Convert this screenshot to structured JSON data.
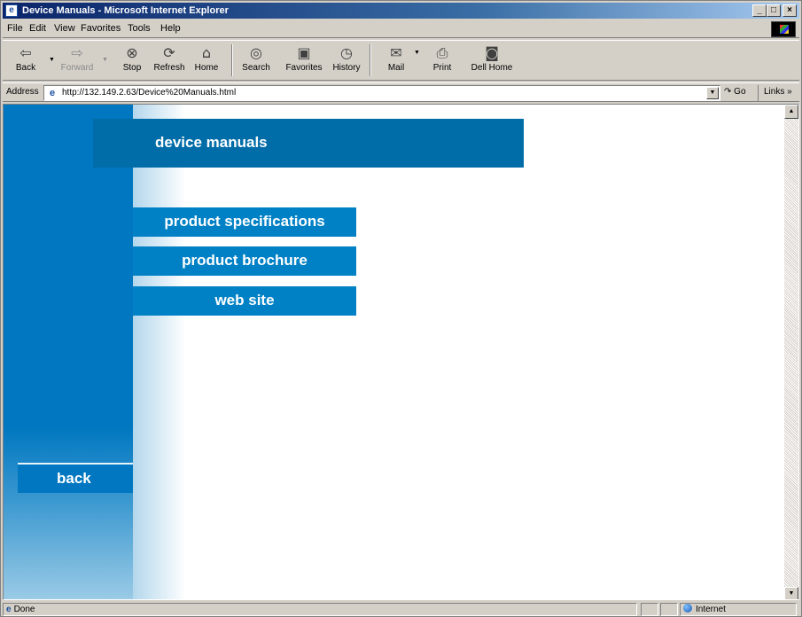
{
  "window": {
    "title": "Device Manuals - Microsoft Internet Explorer",
    "buttons": [
      "_",
      "□",
      "×"
    ]
  },
  "menu": [
    "File",
    "Edit",
    "View",
    "Favorites",
    "Tools",
    "Help"
  ],
  "toolbar": {
    "back": {
      "label": "Back",
      "icon": "back-arrow-icon"
    },
    "forward": {
      "label": "Forward",
      "icon": "forward-arrow-icon"
    },
    "stop": {
      "label": "Stop",
      "icon": "stop-icon"
    },
    "refresh": {
      "label": "Refresh",
      "icon": "refresh-icon"
    },
    "home": {
      "label": "Home",
      "icon": "home-icon"
    },
    "search": {
      "label": "Search",
      "icon": "search-icon"
    },
    "favorites": {
      "label": "Favorites",
      "icon": "favorites-icon"
    },
    "history": {
      "label": "History",
      "icon": "history-icon"
    },
    "mail": {
      "label": "Mail",
      "icon": "mail-icon"
    },
    "print": {
      "label": "Print",
      "icon": "print-icon"
    },
    "dell_home": {
      "label": "Dell Home",
      "icon": "dell-home-icon"
    }
  },
  "address": {
    "label": "Address",
    "url": "http://132.149.2.63/Device%20Manuals.html",
    "go_label": "Go",
    "links_label": "Links »"
  },
  "page": {
    "header": "device manuals",
    "nav": [
      "product specifications",
      "product brochure",
      "web site"
    ],
    "back": "back"
  },
  "status": {
    "text": "Done",
    "zone": "Internet"
  },
  "colors": {
    "strip_blue": "#0077c0",
    "header_blue": "#006ca8",
    "button_blue": "#0081c6"
  }
}
